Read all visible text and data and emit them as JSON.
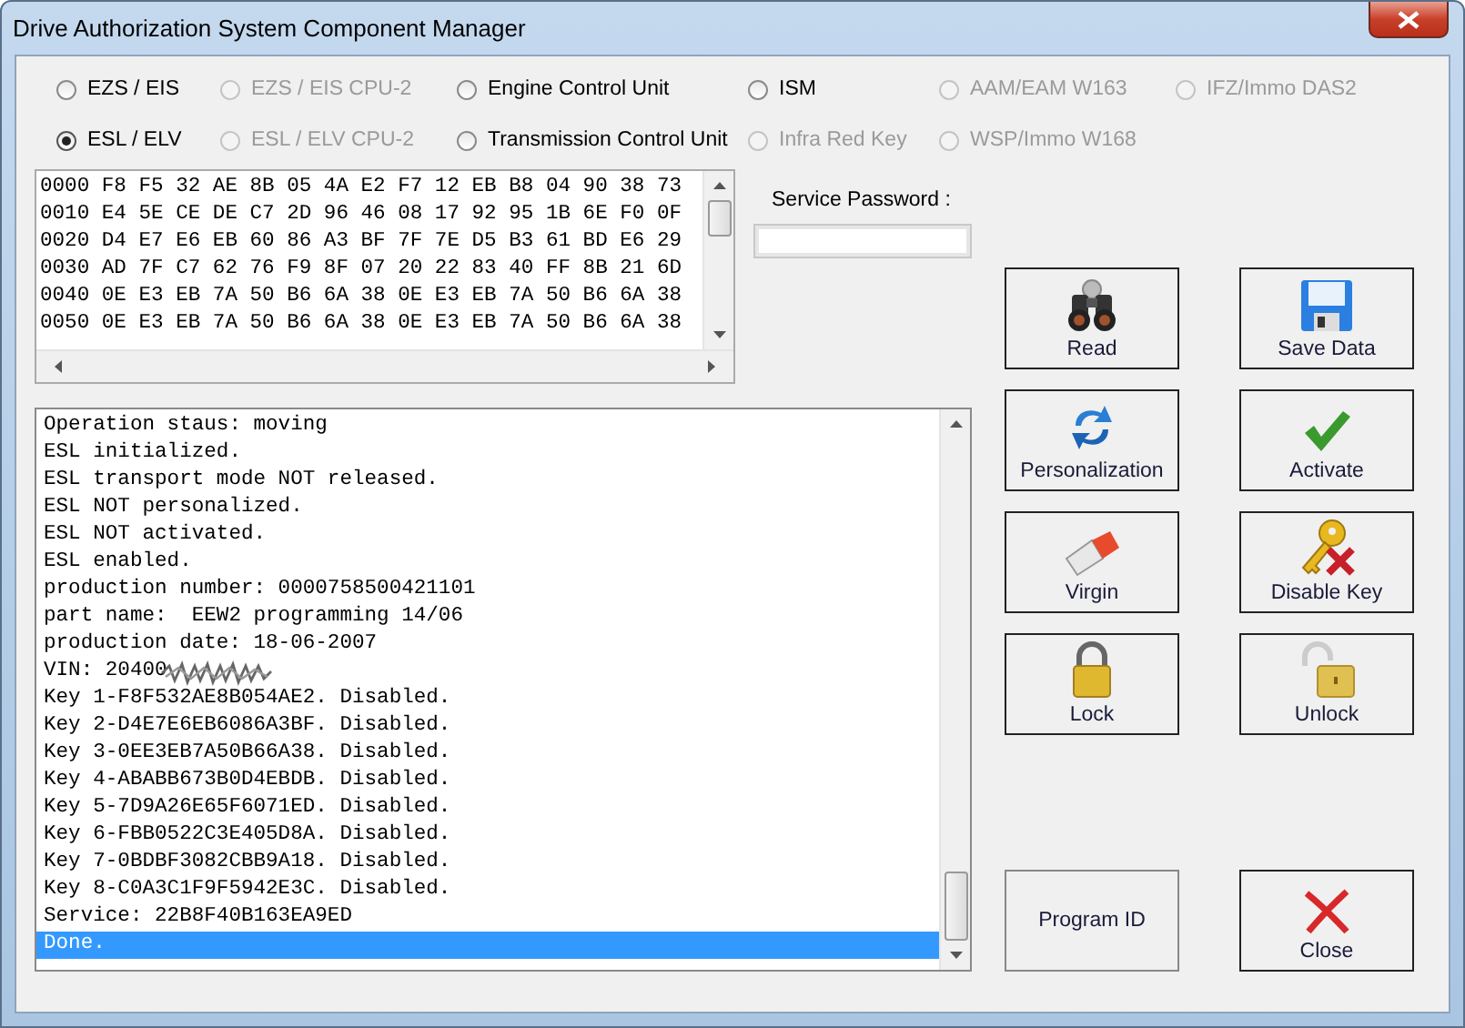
{
  "window": {
    "title": "Drive Authorization System Component Manager"
  },
  "radios": [
    {
      "label": "EZS / EIS",
      "selected": false,
      "disabled": false
    },
    {
      "label": "EZS / EIS CPU-2",
      "selected": false,
      "disabled": true
    },
    {
      "label": "Engine Control Unit",
      "selected": false,
      "disabled": false
    },
    {
      "label": "ISM",
      "selected": false,
      "disabled": false
    },
    {
      "label": "AAM/EAM W163",
      "selected": false,
      "disabled": true
    },
    {
      "label": "IFZ/Immo DAS2",
      "selected": false,
      "disabled": true
    },
    {
      "label": "ESL / ELV",
      "selected": true,
      "disabled": false
    },
    {
      "label": "ESL / ELV CPU-2",
      "selected": false,
      "disabled": true
    },
    {
      "label": "Transmission Control Unit",
      "selected": false,
      "disabled": false
    },
    {
      "label": "Infra Red Key",
      "selected": false,
      "disabled": true
    },
    {
      "label": "WSP/Immo W168",
      "selected": false,
      "disabled": true
    }
  ],
  "hex_rows": [
    "0000 F8 F5 32 AE 8B 05 4A E2 F7 12 EB B8 04 90 38 73",
    "0010 E4 5E CE DE C7 2D 96 46 08 17 92 95 1B 6E F0 0F",
    "0020 D4 E7 E6 EB 60 86 A3 BF 7F 7E D5 B3 61 BD E6 29",
    "0030 AD 7F C7 62 76 F9 8F 07 20 22 83 40 FF 8B 21 6D",
    "0040 0E E3 EB 7A 50 B6 6A 38 0E E3 EB 7A 50 B6 6A 38",
    "0050 0E E3 EB 7A 50 B6 6A 38 0E E3 EB 7A 50 B6 6A 38"
  ],
  "password": {
    "label": "Service Password :"
  },
  "log": [
    {
      "text": "Operation staus: moving",
      "selected": false,
      "redacted": false
    },
    {
      "text": "ESL initialized.",
      "selected": false,
      "redacted": false
    },
    {
      "text": "ESL transport mode NOT released.",
      "selected": false,
      "redacted": false
    },
    {
      "text": "ESL NOT personalized.",
      "selected": false,
      "redacted": false
    },
    {
      "text": "ESL NOT activated.",
      "selected": false,
      "redacted": false
    },
    {
      "text": "ESL enabled.",
      "selected": false,
      "redacted": false
    },
    {
      "text": "production number: 0000758500421101",
      "selected": false,
      "redacted": false
    },
    {
      "text": "part name:  EEW2 programming 14/06",
      "selected": false,
      "redacted": false
    },
    {
      "text": "production date: 18-06-2007",
      "selected": false,
      "redacted": false
    },
    {
      "text": "VIN: 20400",
      "selected": false,
      "redacted": true
    },
    {
      "text": "Key 1-F8F532AE8B054AE2. Disabled.",
      "selected": false,
      "redacted": false
    },
    {
      "text": "Key 2-D4E7E6EB6086A3BF. Disabled.",
      "selected": false,
      "redacted": false
    },
    {
      "text": "Key 3-0EE3EB7A50B66A38. Disabled.",
      "selected": false,
      "redacted": false
    },
    {
      "text": "Key 4-ABABB673B0D4EBDB. Disabled.",
      "selected": false,
      "redacted": false
    },
    {
      "text": "Key 5-7D9A26E65F6071ED. Disabled.",
      "selected": false,
      "redacted": false
    },
    {
      "text": "Key 6-FBB0522C3E405D8A. Disabled.",
      "selected": false,
      "redacted": false
    },
    {
      "text": "Key 7-0BDBF3082CBB9A18. Disabled.",
      "selected": false,
      "redacted": false
    },
    {
      "text": "Key 8-C0A3C1F9F5942E3C. Disabled.",
      "selected": false,
      "redacted": false
    },
    {
      "text": "Service: 22B8F40B163EA9ED",
      "selected": false,
      "redacted": false
    },
    {
      "text": "Done.",
      "selected": true,
      "redacted": false
    }
  ],
  "buttons": [
    {
      "label": "Read",
      "kind": "binoculars"
    },
    {
      "label": "Save Data",
      "kind": "floppy"
    },
    {
      "label": "Personalization",
      "kind": "arrows"
    },
    {
      "label": "Activate",
      "kind": "check"
    },
    {
      "label": "Virgin",
      "kind": "eraser"
    },
    {
      "label": "Disable Key",
      "kind": "key"
    },
    {
      "label": "Lock",
      "kind": "lock"
    },
    {
      "label": "Unlock",
      "kind": "unlock"
    }
  ],
  "bottom_buttons": [
    {
      "label": "Program ID",
      "kind": "plain"
    },
    {
      "label": "Close",
      "kind": "cross"
    }
  ]
}
